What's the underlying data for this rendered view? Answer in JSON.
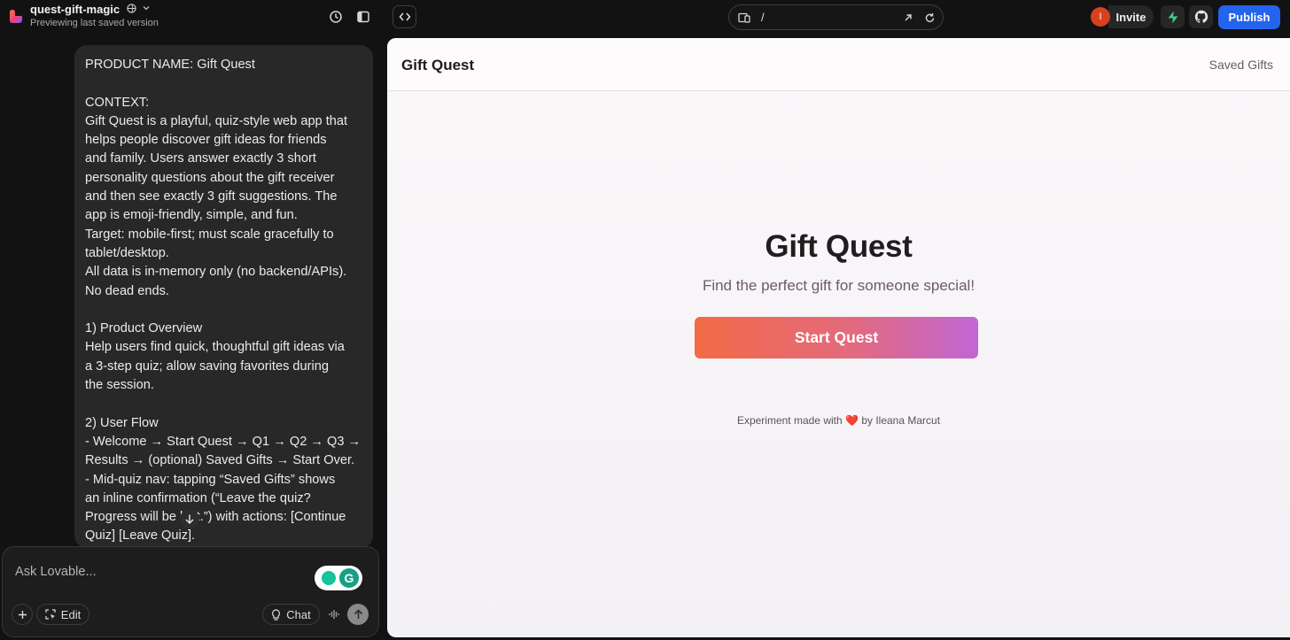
{
  "topbar": {
    "project_name": "quest-gift-magic",
    "project_subtitle": "Previewing last saved version",
    "url_path": "/",
    "avatar_initial": "I",
    "invite_label": "Invite",
    "publish_label": "Publish"
  },
  "chat": {
    "message_lines": [
      "PRODUCT NAME: Gift Quest",
      "",
      "CONTEXT:",
      "Gift Quest is a playful, quiz-style web app that",
      "helps people discover gift ideas for friends",
      "and family. Users answer exactly 3 short",
      "personality questions about the gift receiver",
      "and then see exactly 3 gift suggestions. The",
      "app is emoji-friendly, simple, and fun.",
      "Target: mobile-first; must scale gracefully to",
      "tablet/desktop.",
      "All data is in-memory only (no backend/APIs).",
      "No dead ends.",
      "",
      "1) Product Overview",
      "Help users find quick, thoughtful gift ideas via",
      "a 3-step quiz; allow saving favorites during",
      "the session.",
      "",
      "2) User Flow",
      "- Welcome → Start Quest → Q1 → Q2 → Q3 →",
      "Results → (optional) Saved Gifts → Start Over.",
      "- Mid-quiz nav: tapping “Saved Gifts” shows",
      "an inline confirmation (“Leave the quiz?",
      "Progress will be lost.”) with actions: [Continue",
      "Quiz] [Leave Quiz]."
    ]
  },
  "composer": {
    "placeholder": "Ask Lovable...",
    "edit_label": "Edit",
    "chat_label": "Chat",
    "grammarly_letter": "G"
  },
  "preview": {
    "brand": "Gift Quest",
    "nav_saved": "Saved Gifts",
    "hero_title": "Gift Quest",
    "hero_subtitle": "Find the perfect gift for someone special!",
    "start_button": "Start Quest",
    "footer_before": "Experiment made with",
    "footer_heart": "❤️",
    "footer_after": "by Ileana Marcut"
  },
  "colors": {
    "publish_blue": "#2463eb",
    "button_gradient_start": "#f36a44",
    "button_gradient_end": "#c066d6",
    "supabase_green": "#3ecf8e",
    "avatar_red": "#d8401f"
  }
}
